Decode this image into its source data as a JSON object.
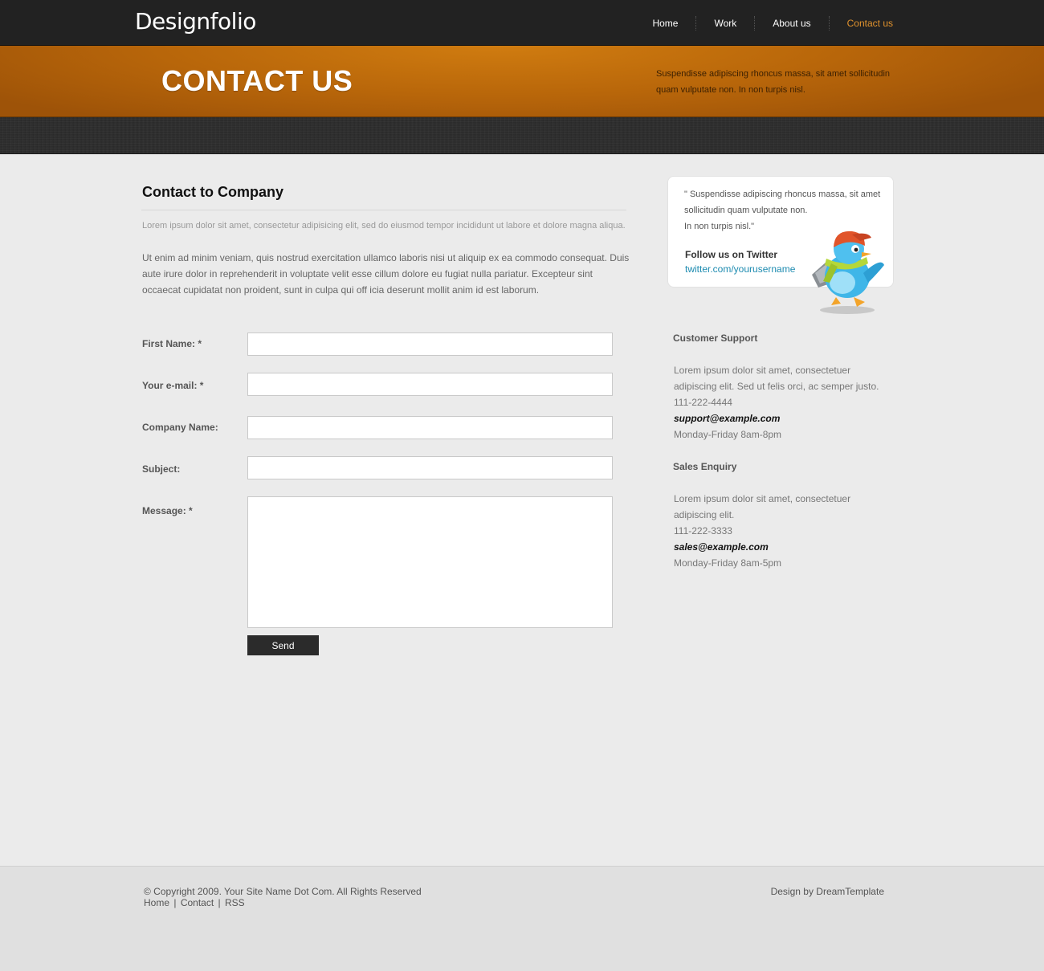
{
  "header": {
    "logo": "Designfolio",
    "nav": [
      {
        "label": "Home",
        "active": false
      },
      {
        "label": "Work",
        "active": false
      },
      {
        "label": "About us",
        "active": false
      },
      {
        "label": "Contact us",
        "active": true
      }
    ],
    "accent_color": "#e0922d"
  },
  "banner": {
    "title": "CONTACT US",
    "text": "Suspendisse adipiscing rhoncus massa, sit amet sollicitudin quam vulputate non. In non turpis nisl."
  },
  "main": {
    "title": "Contact to Company",
    "lead": "Lorem ipsum dolor sit amet, consectetur adipisicing elit, sed do eiusmod tempor incididunt ut labore et dolore magna aliqua.",
    "intro": "Ut enim ad minim veniam, quis nostrud exercitation ullamco laboris nisi ut aliquip ex ea commodo consequat. Duis aute irure dolor in reprehenderit in voluptate velit esse cillum dolore eu fugiat nulla pariatur. Excepteur sint occaecat cupidatat non proident, sunt in culpa qui off icia deserunt mollit anim id est laborum."
  },
  "form": {
    "first_name_label": "First Name: *",
    "email_label": "Your e-mail: *",
    "company_label": "Company Name:",
    "subject_label": "Subject:",
    "message_label": "Message: *",
    "first_name_value": "",
    "email_value": "",
    "company_value": "",
    "subject_value": "",
    "message_value": "",
    "send_label": "Send"
  },
  "sidebar": {
    "quote": "\" Suspendisse adipiscing rhoncus massa, sit amet sollicitudin quam vulputate non.\nIn non turpis nisl.\"",
    "twitter_label": "Follow us on Twitter",
    "twitter_link": "twitter.com/yourusername",
    "support": {
      "heading": "Customer Support",
      "text": "Lorem ipsum dolor sit amet, consectetuer adipiscing elit. Sed ut felis orci, ac semper justo.",
      "phone": "111-222-4444",
      "email": "support@example.com",
      "hours": "Monday-Friday 8am-8pm"
    },
    "sales": {
      "heading": "Sales Enquiry",
      "text": "Lorem ipsum dolor sit amet, consectetuer adipiscing elit.",
      "phone": "111-222-3333",
      "email": "sales@example.com",
      "hours": "Monday-Friday 8am-5pm"
    },
    "bird_icon": "twitter-bird-mascot-icon"
  },
  "footer": {
    "copyright": "© Copyright 2009. Your Site Name Dot Com. All Rights Reserved",
    "links": [
      "Home",
      "Contact",
      "RSS"
    ],
    "separator": "|",
    "design_by": "Design by DreamTemplate"
  }
}
